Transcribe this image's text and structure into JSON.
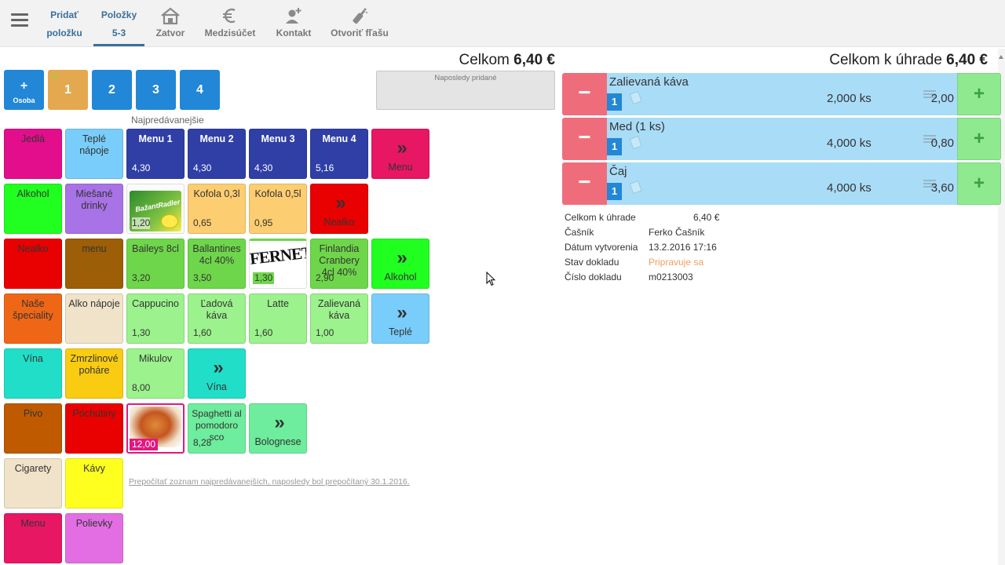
{
  "nav": {
    "tabs": [
      {
        "line1": "Pridať",
        "line2": "položku"
      },
      {
        "line1": "Položky",
        "line2": "5-3"
      }
    ],
    "buttons": [
      {
        "label": "Zatvor",
        "icon": "house-icon"
      },
      {
        "label": "Medzisúčet",
        "icon": "euro-icon"
      },
      {
        "label": "Kontakt",
        "icon": "add-person-icon"
      },
      {
        "label": "Otvoriť fľašu",
        "icon": "bottle-icon"
      }
    ]
  },
  "left_total": {
    "label": "Celkom",
    "amount": "6,40 €"
  },
  "right_total": {
    "label": "Celkom k úhrade",
    "amount": "6,40 €"
  },
  "seats": {
    "add": {
      "symbol": "+",
      "label": "Osoba"
    },
    "items": [
      "1",
      "2",
      "3",
      "4"
    ],
    "checkmark": "✓"
  },
  "recent": {
    "label": "Naposledy pridané"
  },
  "bestsellers_label": "Najpredávanejšie",
  "categories": [
    {
      "label": "Jedlá",
      "color": "#e30e8c"
    },
    {
      "label": "Teplé nápoje",
      "color": "#79cdfb"
    },
    {
      "label": "Alkohol",
      "color": "#21ff21"
    },
    {
      "label": "Miešané drinky",
      "color": "#a873e6"
    },
    {
      "label": "Nealko",
      "color": "#e90000"
    },
    {
      "label": "menu",
      "color": "#9c5e06"
    },
    {
      "label": "Naše špeciality",
      "color": "#ef6716"
    },
    {
      "label": "Alko nápoje",
      "color": "#f0e3c9"
    },
    {
      "label": "Vína",
      "color": "#21dec9"
    },
    {
      "label": "Zmrzlinové poháre",
      "color": "#f9cc12"
    },
    {
      "label": "Pivo",
      "color": "#bf5a00"
    },
    {
      "label": "Pochutiny",
      "color": "#e90000"
    },
    {
      "label": "Cigarety",
      "color": "#f0e3c9"
    },
    {
      "label": "Kávy",
      "color": "#ffff1f"
    },
    {
      "label": "Menu",
      "color": "#e81763"
    },
    {
      "label": "Polievky",
      "color": "#e36ee3"
    }
  ],
  "products": {
    "menu": [
      {
        "label": "Menu 1",
        "price": "4,30"
      },
      {
        "label": "Menu 2",
        "price": "4,30"
      },
      {
        "label": "Menu 3",
        "price": "4,30"
      },
      {
        "label": "Menu 4",
        "price": "5,16"
      }
    ],
    "menu_more": {
      "label": "Menu"
    },
    "row2": [
      {
        "label": "Zlatý Bažant Radler",
        "price": "1,20",
        "image_text": "BažantRadler"
      },
      {
        "label": "Kofola 0,3l",
        "price": "0,65"
      },
      {
        "label": "Kofola 0,5l",
        "price": "0,95"
      }
    ],
    "row2_more": {
      "label": "Nealko"
    },
    "row3": [
      {
        "label": "Baileys 8cl",
        "price": "3,20"
      },
      {
        "label": "Ballantines 4cl 40%",
        "price": "3,50"
      },
      {
        "label": "Fernet",
        "price": "1,30",
        "image_text": "FERNET"
      },
      {
        "label": "Finlandia Cranbery 4cl 40%",
        "price": "2,90"
      }
    ],
    "row3_more": {
      "label": "Alkohol"
    },
    "row4": [
      {
        "label": "Cappucino",
        "price": "1,30"
      },
      {
        "label": "Ľadová káva",
        "price": "1,60"
      },
      {
        "label": "Latte",
        "price": "1,60"
      },
      {
        "label": "Zalievaná káva",
        "price": "1,00"
      }
    ],
    "row4_more": {
      "label": "Teplé"
    },
    "row5": [
      {
        "label": "Mikulov",
        "price": "8,00"
      }
    ],
    "row5_more": {
      "label": "Vína"
    },
    "row6": [
      {
        "label": "Lasagne",
        "price": "12,00"
      },
      {
        "label": "Spaghetti al pomodoro sco",
        "price": "8,28"
      }
    ],
    "row6_more": {
      "label": "Bolognese"
    }
  },
  "recalc_link": "Prepočítať zoznam najpredávanejších, naposledy bol prepočítaný 30.1.2016.",
  "order_items": [
    {
      "name": "Zalievaná káva",
      "badge": "1",
      "qty": "2,000 ks",
      "price": "2,00"
    },
    {
      "name": "Med (1 ks)",
      "badge": "1",
      "qty": "4,000 ks",
      "price": "0,80"
    },
    {
      "name": "Čaj",
      "badge": "1",
      "qty": "4,000 ks",
      "price": "3,60"
    }
  ],
  "order_buttons": {
    "minus": "−",
    "plus": "+"
  },
  "info": [
    {
      "label": "Celkom k úhrade",
      "value": "6,40 €"
    },
    {
      "label": "Čašník",
      "value": "Ferko Čašník"
    },
    {
      "label": "Dátum vytvorenia",
      "value": "13.2.2016 17:16"
    },
    {
      "label": "Stav dokladu",
      "value": "Pripravuje sa"
    },
    {
      "label": "Číslo dokladu",
      "value": "m0213003"
    }
  ],
  "colors": {
    "accent_blue": "#2187d6",
    "menu_blue": "#2f3fa6",
    "status_orange": "#f0a060",
    "order_item_bg": "#a9dcf7",
    "order_minus": "#ef6d7a",
    "order_plus": "#8fe98f"
  },
  "arrow_glyph": "»"
}
